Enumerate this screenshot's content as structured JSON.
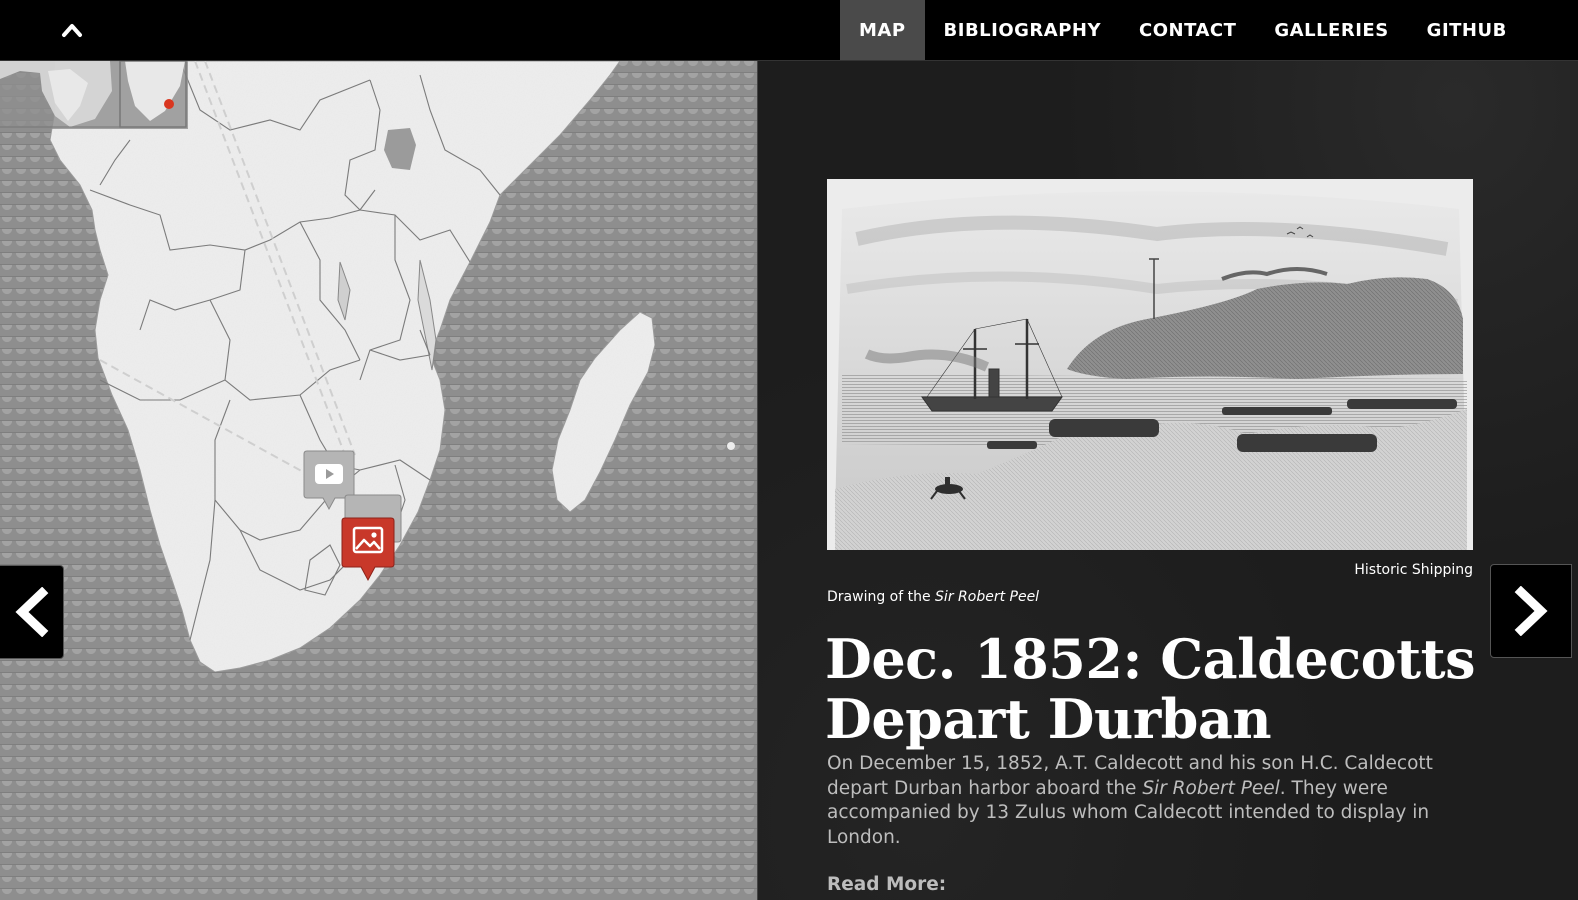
{
  "nav": {
    "back_to_top_icon": "chevron-up-icon",
    "items": [
      {
        "label": "MAP",
        "active": true
      },
      {
        "label": "BIBLIOGRAPHY",
        "active": false
      },
      {
        "label": "CONTACT",
        "active": false
      },
      {
        "label": "GALLERIES",
        "active": false
      },
      {
        "label": "GITHUB",
        "active": false
      }
    ]
  },
  "map": {
    "markers": [
      {
        "type": "video",
        "icon": "play-icon",
        "color": "#b5b5b5"
      },
      {
        "type": "image",
        "icon": "image-icon",
        "color": "#b5b5b5"
      },
      {
        "type": "image",
        "icon": "image-icon",
        "color": "#c8382a",
        "active": true
      }
    ],
    "minimap_dot_color": "#d9361f"
  },
  "slide": {
    "image_alt": "Drawing of the Sir Robert Peel steamship departing Durban",
    "credit": "Historic Shipping",
    "caption_prefix": "Drawing of the ",
    "caption_ship": "Sir Robert Peel",
    "title": "Dec. 1852: Caldecotts Depart Durban",
    "body_part1": "On December 15, 1852, A.T. Caldecott and his son H.C. Caldecott depart Durban harbor aboard the ",
    "body_ship": "Sir Robert Peel",
    "body_part2": ".  They were accompanied by 13 Zulus whom Caldecott intended to display in London.",
    "read_more": "Read More:"
  },
  "arrows": {
    "prev_icon": "chevron-left-icon",
    "next_icon": "chevron-right-icon"
  }
}
